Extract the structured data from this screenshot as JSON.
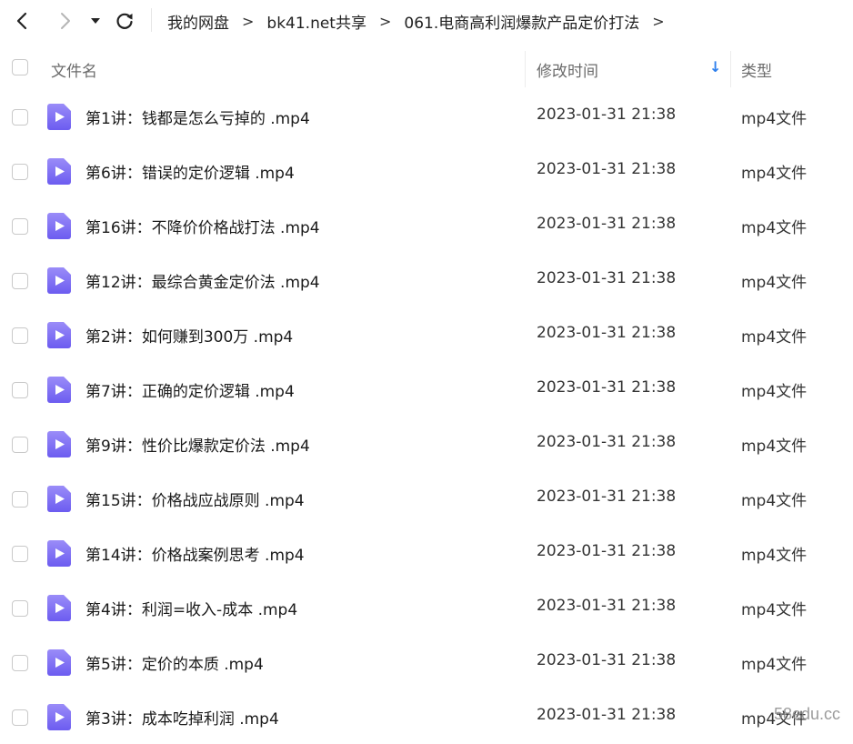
{
  "breadcrumb": [
    "我的网盘",
    "bk41.net共享",
    "061.电商高利润爆款产品定价打法"
  ],
  "breadcrumb_separator": ">",
  "columns": {
    "name": "文件名",
    "modified": "修改时间",
    "type": "类型"
  },
  "sort_indicator": "↓",
  "files": [
    {
      "name": "第1讲：钱都是怎么亏掉的 .mp4",
      "modified": "2023-01-31 21:38",
      "type": "mp4文件"
    },
    {
      "name": "第6讲：错误的定价逻辑 .mp4",
      "modified": "2023-01-31 21:38",
      "type": "mp4文件"
    },
    {
      "name": "第16讲：不降价价格战打法 .mp4",
      "modified": "2023-01-31 21:38",
      "type": "mp4文件"
    },
    {
      "name": "第12讲：最综合黄金定价法 .mp4",
      "modified": "2023-01-31 21:38",
      "type": "mp4文件"
    },
    {
      "name": "第2讲：如何赚到300万 .mp4",
      "modified": "2023-01-31 21:38",
      "type": "mp4文件"
    },
    {
      "name": "第7讲：正确的定价逻辑 .mp4",
      "modified": "2023-01-31 21:38",
      "type": "mp4文件"
    },
    {
      "name": "第9讲：性价比爆款定价法 .mp4",
      "modified": "2023-01-31 21:38",
      "type": "mp4文件"
    },
    {
      "name": "第15讲：价格战应战原则 .mp4",
      "modified": "2023-01-31 21:38",
      "type": "mp4文件"
    },
    {
      "name": "第14讲：价格战案例思考 .mp4",
      "modified": "2023-01-31 21:38",
      "type": "mp4文件"
    },
    {
      "name": "第4讲：利润=收入-成本 .mp4",
      "modified": "2023-01-31 21:38",
      "type": "mp4文件"
    },
    {
      "name": "第5讲：定价的本质 .mp4",
      "modified": "2023-01-31 21:38",
      "type": "mp4文件"
    },
    {
      "name": "第3讲：成本吃掉利润 .mp4",
      "modified": "2023-01-31 21:38",
      "type": "mp4文件"
    }
  ],
  "watermark": "58edu.cc",
  "colors": {
    "file_icon_gradient_start": "#8b7cf6",
    "file_icon_gradient_end": "#6d5ef0",
    "sort_arrow": "#2f80ed"
  },
  "icons": {
    "back": "chevron-left-icon",
    "forward": "chevron-right-icon",
    "dropdown": "caret-down-icon",
    "refresh": "refresh-icon",
    "file": "video-file-icon"
  }
}
